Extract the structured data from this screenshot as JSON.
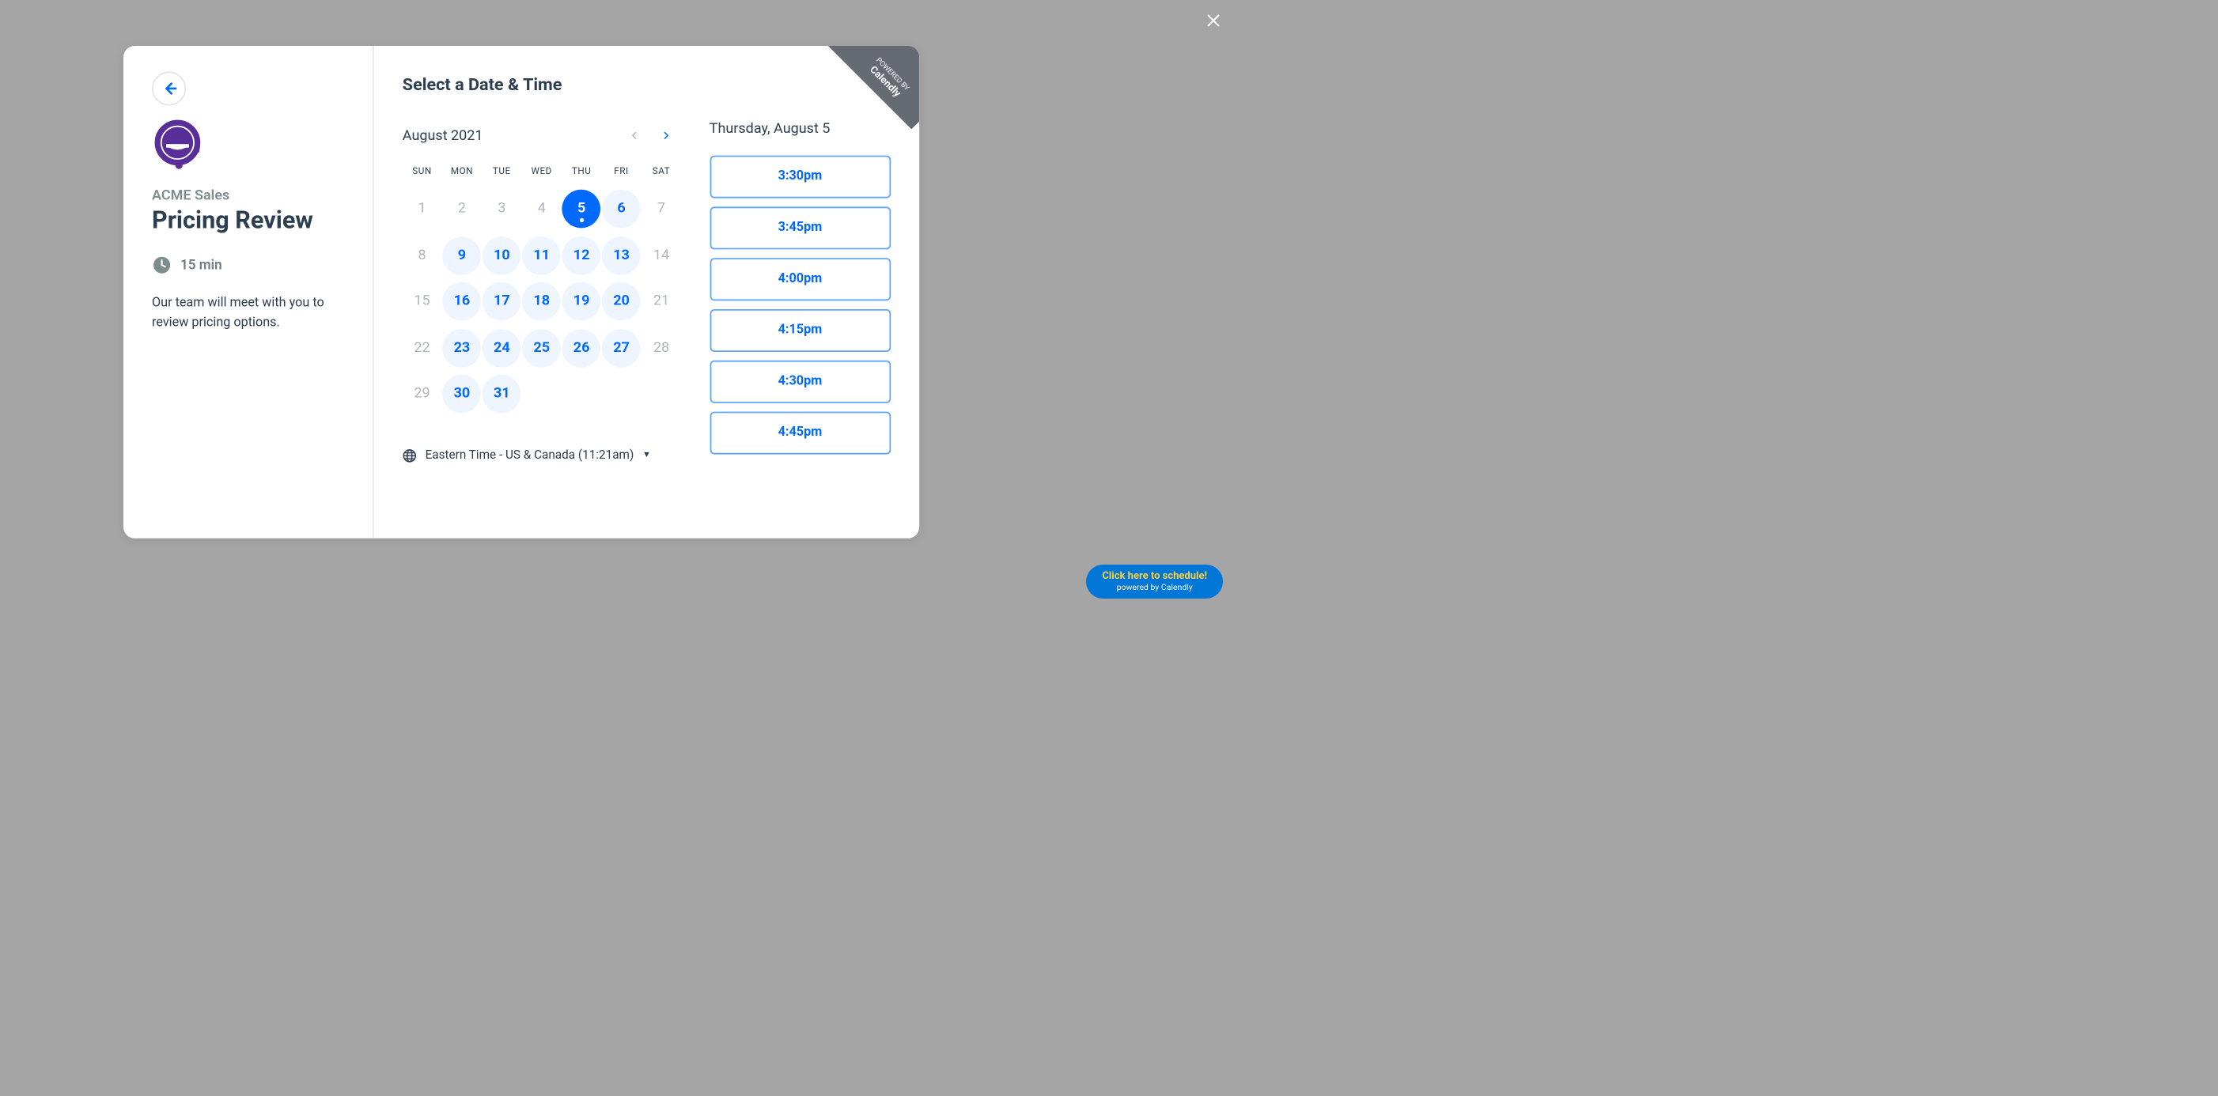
{
  "close_label": "Close",
  "sidebar": {
    "company": "ACME Sales",
    "event_title": "Pricing Review",
    "duration": "15 min",
    "description": "Our team will meet with you to review pricing options."
  },
  "main": {
    "title": "Select a Date & Time",
    "month": "August 2021",
    "dow": [
      "SUN",
      "MON",
      "TUE",
      "WED",
      "THU",
      "FRI",
      "SAT"
    ],
    "days": [
      {
        "n": "1",
        "state": "disabled"
      },
      {
        "n": "2",
        "state": "disabled"
      },
      {
        "n": "3",
        "state": "disabled"
      },
      {
        "n": "4",
        "state": "disabled"
      },
      {
        "n": "5",
        "state": "selected"
      },
      {
        "n": "6",
        "state": "available"
      },
      {
        "n": "7",
        "state": "disabled"
      },
      {
        "n": "8",
        "state": "disabled"
      },
      {
        "n": "9",
        "state": "available"
      },
      {
        "n": "10",
        "state": "available"
      },
      {
        "n": "11",
        "state": "available"
      },
      {
        "n": "12",
        "state": "available"
      },
      {
        "n": "13",
        "state": "available"
      },
      {
        "n": "14",
        "state": "disabled"
      },
      {
        "n": "15",
        "state": "disabled"
      },
      {
        "n": "16",
        "state": "available"
      },
      {
        "n": "17",
        "state": "available"
      },
      {
        "n": "18",
        "state": "available"
      },
      {
        "n": "19",
        "state": "available"
      },
      {
        "n": "20",
        "state": "available"
      },
      {
        "n": "21",
        "state": "disabled"
      },
      {
        "n": "22",
        "state": "disabled"
      },
      {
        "n": "23",
        "state": "available"
      },
      {
        "n": "24",
        "state": "available"
      },
      {
        "n": "25",
        "state": "available"
      },
      {
        "n": "26",
        "state": "available"
      },
      {
        "n": "27",
        "state": "available"
      },
      {
        "n": "28",
        "state": "disabled"
      },
      {
        "n": "29",
        "state": "disabled"
      },
      {
        "n": "30",
        "state": "available"
      },
      {
        "n": "31",
        "state": "available"
      }
    ],
    "timezone": "Eastern Time - US & Canada (11:21am)",
    "selected_date": "Thursday, August 5",
    "slots": [
      "3:30pm",
      "3:45pm",
      "4:00pm",
      "4:15pm",
      "4:30pm",
      "4:45pm"
    ]
  },
  "powered": {
    "label": "POWERED BY",
    "brand": "Calendly"
  },
  "cta": {
    "title": "Click here to schedule!",
    "sub": "powered by Calendly"
  }
}
